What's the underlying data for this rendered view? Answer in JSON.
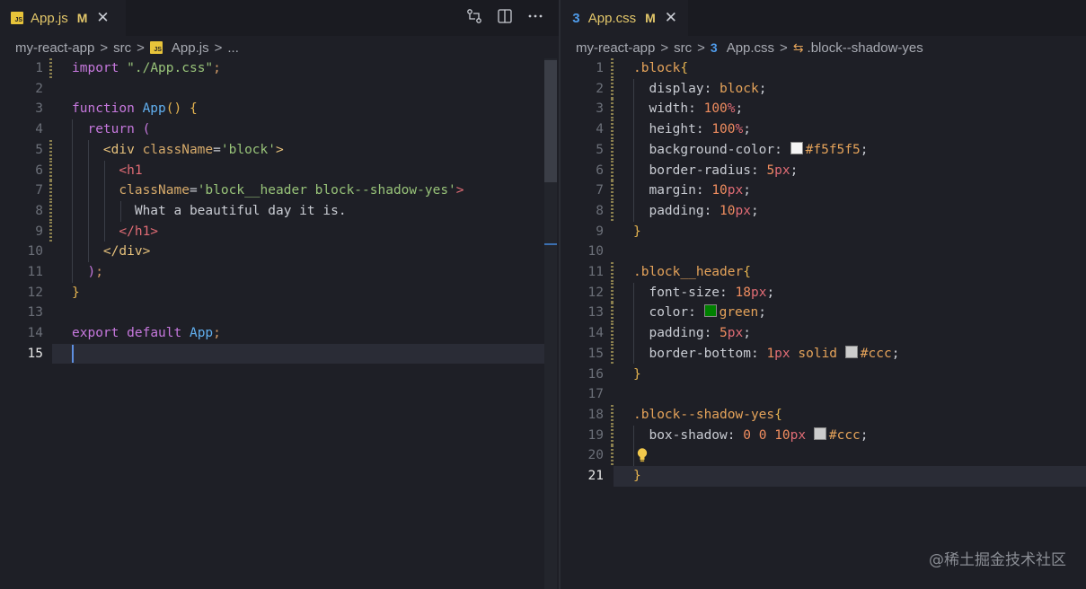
{
  "left": {
    "tab": {
      "title": "App.js",
      "modified": "M",
      "close": "✕",
      "icon": "js-file-icon",
      "icon_text": "JS"
    },
    "breadcrumb": [
      "my-react-app",
      "src",
      "App.js",
      "..."
    ],
    "active_line": 15,
    "lines": [
      {
        "n": "1",
        "html": "<span class='kw'>import</span> <span class='str'>\"./App.css\"</span><span class='punc'>;</span>"
      },
      {
        "n": "2",
        "html": ""
      },
      {
        "n": "3",
        "html": "<span class='kw'>function</span> <span class='fn'>App</span><span class='paren'>()</span> <span class='paren'>{</span>"
      },
      {
        "n": "4",
        "html": "  <span class='kw'>return</span> <span class='paren2'>(</span>"
      },
      {
        "n": "5",
        "html": "    <span class='tag'>&lt;div</span> <span class='attr'>className</span><span class='txt'>=</span><span class='str'>'block'</span><span class='tag'>&gt;</span>"
      },
      {
        "n": "6",
        "html": "      <span class='tag2'>&lt;h1</span>"
      },
      {
        "n": "7",
        "html": "      <span class='attr'>className</span><span class='txt'>=</span><span class='str'>'block__header block--shadow-yes'</span><span class='tag2'>&gt;</span>"
      },
      {
        "n": "8",
        "html": "        <span class='txt'>What a beautiful day it is.</span>"
      },
      {
        "n": "9",
        "html": "      <span class='tag2'>&lt;/h1&gt;</span>"
      },
      {
        "n": "10",
        "html": "    <span class='tag'>&lt;/div&gt;</span>"
      },
      {
        "n": "11",
        "html": "  <span class='paren2'>)</span><span class='punc'>;</span>"
      },
      {
        "n": "12",
        "html": "<span class='paren'>}</span>"
      },
      {
        "n": "13",
        "html": ""
      },
      {
        "n": "14",
        "html": "<span class='kw'>export</span> <span class='kw'>default</span> <span class='fn'>App</span><span class='punc'>;</span>"
      },
      {
        "n": "15",
        "html": ""
      }
    ]
  },
  "right": {
    "tab": {
      "title": "App.css",
      "modified": "M",
      "close": "✕",
      "icon": "css-file-icon",
      "icon_text": "3"
    },
    "breadcrumb": [
      "my-react-app",
      "src",
      "App.css",
      ".block--shadow-yes"
    ],
    "active_line": 21,
    "lines": [
      {
        "n": "1",
        "html": "<span class='sel'>.block</span><span class='paren'>{</span>"
      },
      {
        "n": "2",
        "html": "  <span class='prop'>display</span><span class='txt'>:</span> <span class='val'>block</span><span class='txt'>;</span>"
      },
      {
        "n": "3",
        "html": "  <span class='prop'>width</span><span class='txt'>:</span> <span class='num'>100</span><span class='unit'>%</span><span class='txt'>;</span>"
      },
      {
        "n": "4",
        "html": "  <span class='prop'>height</span><span class='txt'>:</span> <span class='num'>100</span><span class='unit'>%</span><span class='txt'>;</span>"
      },
      {
        "n": "5",
        "html": "  <span class='prop'>background-color</span><span class='txt'>:</span> <span class='swatch' style='background:#f5f5f5'></span><span class='val'>#f5f5f5</span><span class='txt'>;</span>"
      },
      {
        "n": "6",
        "html": "  <span class='prop'>border-radius</span><span class='txt'>:</span> <span class='num'>5</span><span class='unit'>px</span><span class='txt'>;</span>"
      },
      {
        "n": "7",
        "html": "  <span class='prop'>margin</span><span class='txt'>:</span> <span class='num'>10</span><span class='unit'>px</span><span class='txt'>;</span>"
      },
      {
        "n": "8",
        "html": "  <span class='prop'>padding</span><span class='txt'>:</span> <span class='num'>10</span><span class='unit'>px</span><span class='txt'>;</span>"
      },
      {
        "n": "9",
        "html": "<span class='paren'>}</span>"
      },
      {
        "n": "10",
        "html": ""
      },
      {
        "n": "11",
        "html": "<span class='sel'>.block__header</span><span class='paren'>{</span>"
      },
      {
        "n": "12",
        "html": "  <span class='prop'>font-size</span><span class='txt'>:</span> <span class='num'>18</span><span class='unit'>px</span><span class='txt'>;</span>"
      },
      {
        "n": "13",
        "html": "  <span class='prop'>color</span><span class='txt'>:</span> <span class='swatch' style='background:#008000'></span><span class='val'>green</span><span class='txt'>;</span>"
      },
      {
        "n": "14",
        "html": "  <span class='prop'>padding</span><span class='txt'>:</span> <span class='num'>5</span><span class='unit'>px</span><span class='txt'>;</span>"
      },
      {
        "n": "15",
        "html": "  <span class='prop'>border-bottom</span><span class='txt'>:</span> <span class='num'>1</span><span class='unit'>px</span> <span class='val'>solid</span> <span class='swatch' style='background:#cccccc'></span><span class='val'>#ccc</span><span class='txt'>;</span>"
      },
      {
        "n": "16",
        "html": "<span class='paren'>}</span>"
      },
      {
        "n": "17",
        "html": ""
      },
      {
        "n": "18",
        "html": "<span class='sel'>.block--shadow-yes</span><span class='paren'>{</span>"
      },
      {
        "n": "19",
        "html": "  <span class='prop'>box-shadow</span><span class='txt'>:</span> <span class='num'>0</span> <span class='num'>0</span> <span class='num'>10</span><span class='unit'>px</span> <span class='swatch' style='background:#cccccc'></span><span class='val'>#ccc</span><span class='txt'>;</span>"
      },
      {
        "n": "20",
        "html": ""
      },
      {
        "n": "21",
        "html": "<span class='paren'>}</span>"
      }
    ]
  },
  "watermark": "@稀土掘金技术社区",
  "colors": {
    "accent": "#e3c76a",
    "caret": "#5e8fe0",
    "background": "#1e1f26"
  }
}
